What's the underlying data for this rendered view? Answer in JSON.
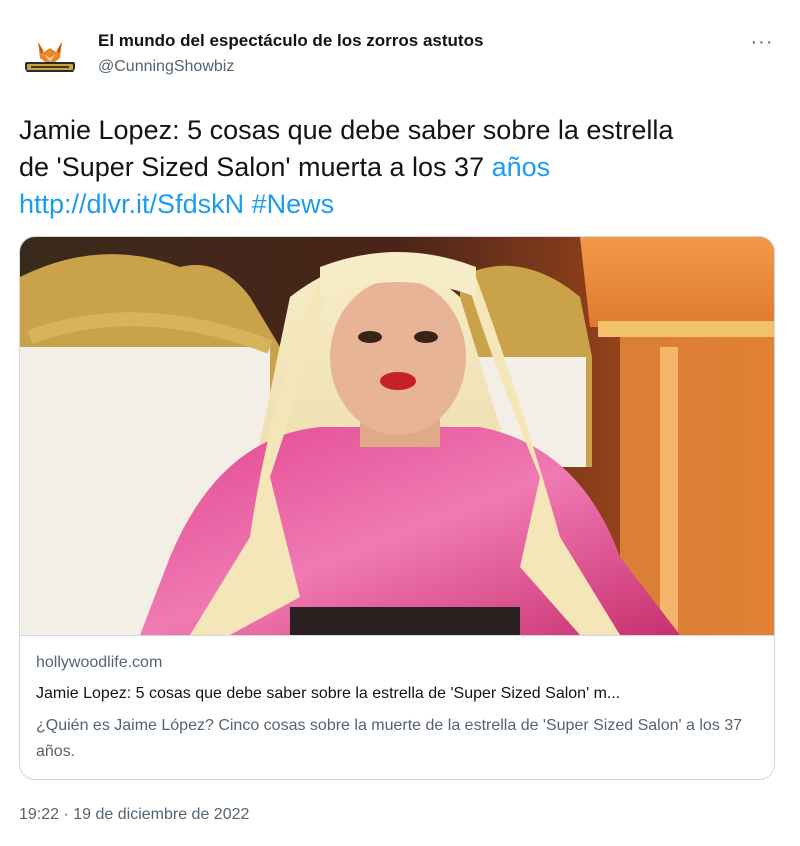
{
  "author": {
    "name": "El mundo del espectáculo de los zorros astutos",
    "handle": "@CunningShowbiz",
    "avatar_icon": "fox-logo-icon",
    "avatar_banner_text": "CUNNINGSHOWBIZ"
  },
  "more_icon": "more-horizontal-icon",
  "more_label": "···",
  "tweet": {
    "text_line1": "Jamie Lopez: 5 cosas que debe saber sobre la estrella",
    "text_line2": "de 'Super Sized Salon' muerta a los 37 ",
    "text_link_word": "años",
    "url": "http://dlvr.it/SfdskN",
    "hashtag": "#News",
    "link_color": "#1d9bf0"
  },
  "card": {
    "image_icon": "photo-person-blonde-wig-pink-top-throne",
    "domain": "hollywoodlife.com",
    "title": "Jamie Lopez: 5 cosas que debe saber sobre la estrella de 'Super Sized Salon' m...",
    "description": "¿Quién es Jaime López? Cinco cosas sobre la muerte de la estrella de 'Super Sized Salon' a los 37 años."
  },
  "timestamp": "19:22 · 19 de diciembre de 2022"
}
